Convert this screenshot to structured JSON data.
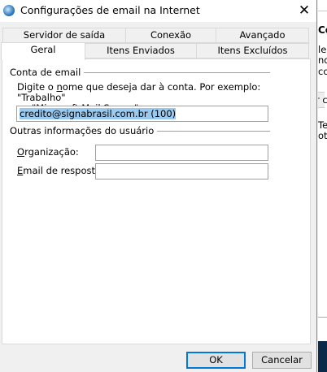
{
  "window": {
    "title": "Configurações de email na Internet",
    "close_icon": "close-icon",
    "app_icon": "globe-mail-icon"
  },
  "tabs_row1": [
    {
      "label": "Servidor de saída"
    },
    {
      "label": "Conexão"
    },
    {
      "label": "Avançado"
    }
  ],
  "tabs_row2": [
    {
      "label": "Geral",
      "active": true
    },
    {
      "label": "Itens Enviados"
    },
    {
      "label": "Itens Excluídos"
    }
  ],
  "account": {
    "group_label": "Conta de email",
    "description_line1_pre": "Digite o ",
    "description_line1_accel": "n",
    "description_line1_post": "ome que deseja dar à conta. Por exemplo: \"Trabalho\"",
    "description_line2": "ou \"Microsoft Mail Server\"",
    "name_value": "credito@signabrasil.com.br (100)"
  },
  "user_info": {
    "group_label": "Outras informações do usuário",
    "organization_accel": "O",
    "organization_label_rest": "rganização:",
    "organization_value": "",
    "reply_accel": "E",
    "reply_label_rest": "mail de resposta:",
    "reply_value": ""
  },
  "buttons": {
    "ok": "OK",
    "cancel": "Cancelar"
  },
  "background_fragments": [
    "Co",
    "le",
    "ndá",
    "co",
    "r co",
    "Tes",
    "ot"
  ],
  "colors": {
    "accent": "#0078d7",
    "selection": "#99c9ef",
    "taskbar": "#0b2a4a"
  }
}
